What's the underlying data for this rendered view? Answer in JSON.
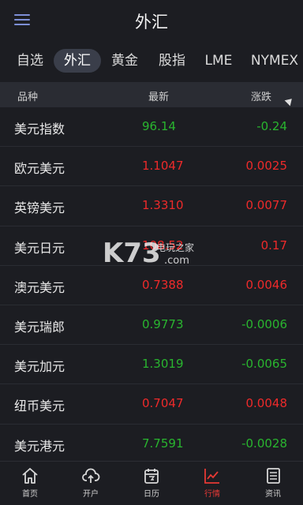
{
  "header": {
    "title": "外汇"
  },
  "tabs": [
    {
      "label": "自选"
    },
    {
      "label": "外汇"
    },
    {
      "label": "黄金"
    },
    {
      "label": "股指"
    },
    {
      "label": "LME"
    },
    {
      "label": "NYMEX"
    }
  ],
  "table": {
    "columns": [
      "品种",
      "最新",
      "涨跌"
    ],
    "rows": [
      {
        "name": "美元指数",
        "price": "96.14",
        "change": "-0.24",
        "trend": "down"
      },
      {
        "name": "欧元美元",
        "price": "1.1047",
        "change": "0.0025",
        "trend": "up"
      },
      {
        "name": "英镑美元",
        "price": "1.3310",
        "change": "0.0077",
        "trend": "up"
      },
      {
        "name": "美元日元",
        "price": "108.52",
        "change": "0.17",
        "trend": "up"
      },
      {
        "name": "澳元美元",
        "price": "0.7388",
        "change": "0.0046",
        "trend": "up"
      },
      {
        "name": "美元瑞郎",
        "price": "0.9773",
        "change": "-0.0006",
        "trend": "down"
      },
      {
        "name": "美元加元",
        "price": "1.3019",
        "change": "-0.0065",
        "trend": "down"
      },
      {
        "name": "纽币美元",
        "price": "0.7047",
        "change": "0.0048",
        "trend": "up"
      },
      {
        "name": "美元港元",
        "price": "7.7591",
        "change": "-0.0028",
        "trend": "down"
      }
    ]
  },
  "watermark": {
    "brand": "K73",
    "text": "电玩之家",
    "domain": ".com"
  },
  "bottom_nav": [
    {
      "label": "首页",
      "icon": "home-icon"
    },
    {
      "label": "开户",
      "icon": "cloud-upload-icon"
    },
    {
      "label": "日历",
      "icon": "calendar-icon"
    },
    {
      "label": "行情",
      "icon": "chart-icon"
    },
    {
      "label": "资讯",
      "icon": "news-icon"
    }
  ],
  "colors": {
    "up": "#ee2a2a",
    "down": "#29b52f",
    "active_nav": "#e53935",
    "menu": "#7d8fd6"
  }
}
